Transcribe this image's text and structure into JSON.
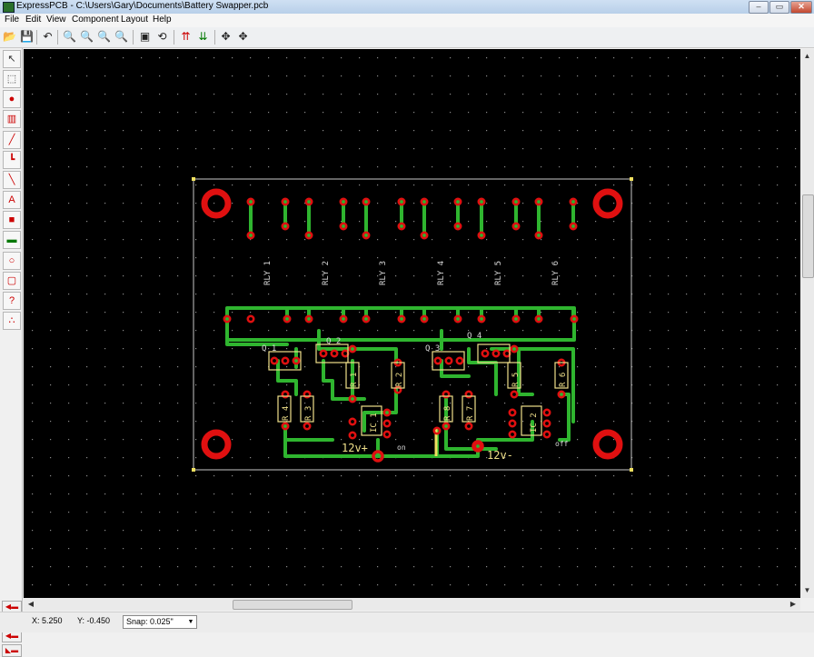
{
  "window": {
    "title": "ExpressPCB - C:\\Users\\Gary\\Documents\\Battery Swapper.pcb"
  },
  "menu": [
    "File",
    "Edit",
    "View",
    "Component",
    "Layout",
    "Help"
  ],
  "board": {
    "relay_labels": [
      "RLY 1",
      "RLY 2",
      "RLY 3",
      "RLY 4",
      "RLY 5",
      "RLY 6"
    ],
    "transistors": [
      "Q 1",
      "Q 2",
      "Q 3",
      "Q 4"
    ],
    "resistors": [
      "R 1",
      "R 2",
      "R 3",
      "R 4",
      "R 5",
      "R 6",
      "R 7",
      "R 8"
    ],
    "ics": [
      "IC 1",
      "IC 2"
    ],
    "power_pos": "12v+",
    "power_neg": "12v-",
    "switch_on": "on",
    "switch_off": "off",
    "colors": {
      "copper": "#2fb52f",
      "pad": "#e01010",
      "silk": "#f0e08a",
      "background": "#000000"
    }
  },
  "status": {
    "x": "X: 5.250",
    "y": "Y: -0.450",
    "snap": "Snap: 0.025\""
  }
}
